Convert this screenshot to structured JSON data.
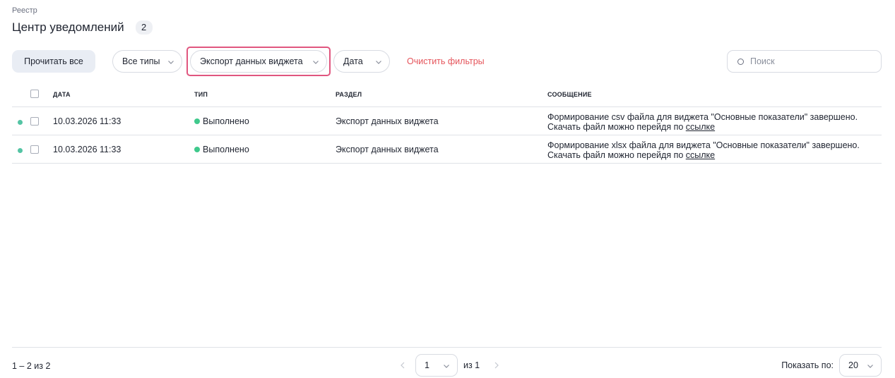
{
  "breadcrumb": "Реестр",
  "page": {
    "title": "Центр уведомлений",
    "count": "2"
  },
  "toolbar": {
    "read_all": "Прочитать все",
    "type_filter": "Все типы",
    "section_filter": "Экспорт данных виджета",
    "date_filter": "Дата",
    "clear_filters": "Очистить фильтры",
    "search_placeholder": "Поиск"
  },
  "table": {
    "headers": {
      "date": "ДАТА",
      "type": "ТИП",
      "section": "РАЗДЕЛ",
      "message": "СООБЩЕНИЕ"
    },
    "rows": [
      {
        "date": "10.03.2026 11:33",
        "type": "Выполнено",
        "section": "Экспорт данных виджета",
        "message_line1": "Формирование csv файла для виджета \"Основные показатели\" завершено.",
        "message_line2": "Скачать файл можно перейдя по ",
        "link": "ссылке"
      },
      {
        "date": "10.03.2026 11:33",
        "type": "Выполнено",
        "section": "Экспорт данных виджета",
        "message_line1": "Формирование xlsx файла для виджета \"Основные показатели\" завершено.",
        "message_line2": "Скачать файл можно перейдя по ",
        "link": "ссылке"
      }
    ]
  },
  "footer": {
    "range": "1 – 2 из 2",
    "current_page": "1",
    "of_pages": "из 1",
    "per_page_label": "Показать по:",
    "per_page_value": "20"
  },
  "colors": {
    "accent_highlight": "#e0567f",
    "danger": "#e5535a",
    "success": "#3fc98c",
    "unread": "#54c4a4"
  }
}
